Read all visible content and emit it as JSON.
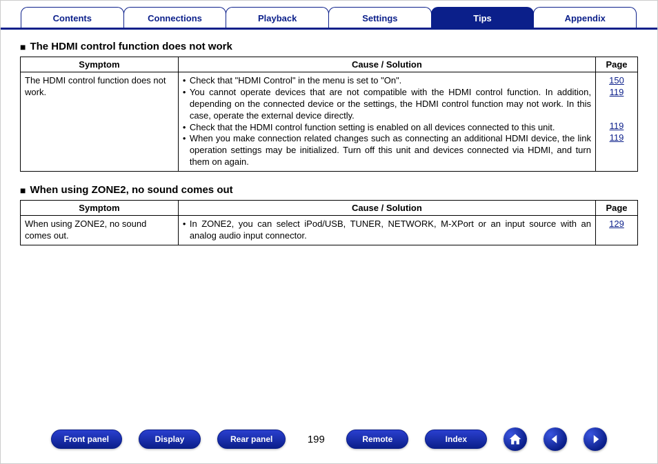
{
  "tabs": {
    "contents": "Contents",
    "connections": "Connections",
    "playback": "Playback",
    "settings": "Settings",
    "tips": "Tips",
    "appendix": "Appendix"
  },
  "activeTab": "tips",
  "section1": {
    "title": "The HDMI control function does not work",
    "headers": {
      "symptom": "Symptom",
      "solution": "Cause / Solution",
      "page": "Page"
    },
    "symptom": "The HDMI control function does not work.",
    "solutions": [
      "Check that \"HDMI Control\" in the menu is set to \"On\".",
      "You cannot operate devices that are not compatible with the HDMI control function. In addition, depending on the connected device or the settings, the HDMI control function may not work. In this case, operate the external device directly.",
      "Check that the HDMI control function setting is enabled on all devices connected to this unit.",
      "When you make connection related changes such as connecting an additional HDMI device, the link operation settings may be initialized. Turn off this unit and devices connected via HDMI, and turn them on again."
    ],
    "pages": [
      "150",
      "119",
      "119",
      "119"
    ]
  },
  "section2": {
    "title": "When using ZONE2, no sound comes out",
    "headers": {
      "symptom": "Symptom",
      "solution": "Cause / Solution",
      "page": "Page"
    },
    "symptom": "When using ZONE2, no sound comes out.",
    "solutions": [
      "In ZONE2, you can select iPod/USB, TUNER, NETWORK, M-XPort or an input source with an analog audio input connector."
    ],
    "pages": [
      "129"
    ]
  },
  "bottom": {
    "frontPanel": "Front panel",
    "display": "Display",
    "rearPanel": "Rear panel",
    "remote": "Remote",
    "index": "Index",
    "pageNumber": "199"
  }
}
